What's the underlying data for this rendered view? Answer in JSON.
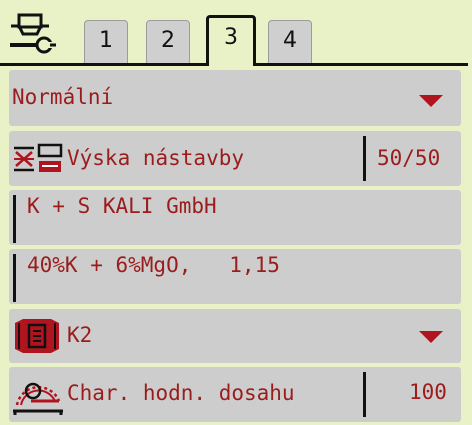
{
  "header": {
    "icon": "spreader-settings-icon",
    "tabs": [
      {
        "label": "1"
      },
      {
        "label": "2"
      },
      {
        "label": "3"
      },
      {
        "label": "4"
      }
    ],
    "active_tab": 2
  },
  "fields": {
    "mode": {
      "value": "Normální",
      "icon": "chevron-down-icon"
    },
    "headland_height": {
      "label": "Výska nástavby",
      "value": "50/50",
      "icon": "boundary-spread-icon"
    },
    "manufacturer": {
      "value": "K + S KALI GmbH"
    },
    "fertilizer": {
      "value": "40%K + 6%MgO,   1,15"
    },
    "disc_type": {
      "value": "K2",
      "icon": "spreading-disc-icon"
    },
    "throw_range": {
      "label": "Char. hodn. dosahu",
      "value": "100",
      "icon": "throw-range-icon"
    }
  },
  "colors": {
    "background": "#e8f2c6",
    "field": "#cdcdcd",
    "text": "#9a1c1c",
    "accent": "#b0141e"
  }
}
